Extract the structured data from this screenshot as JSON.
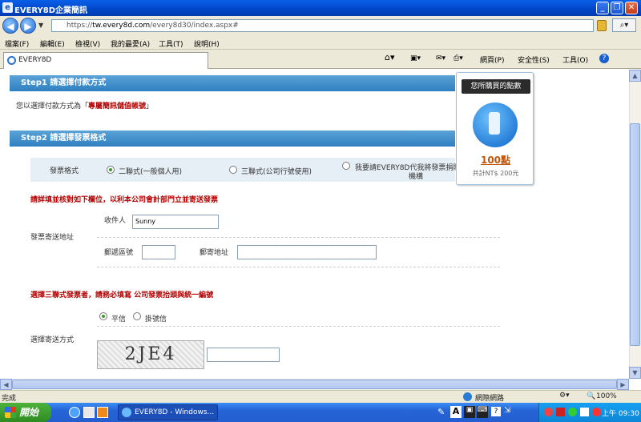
{
  "window": {
    "title": "EVERY8D企業簡訊"
  },
  "address": {
    "prefix": "https://",
    "host": "tw.every8d.com",
    "path": "/every8d30/index.aspx#"
  },
  "menu": [
    "檔案(F)",
    "編輯(E)",
    "檢視(V)",
    "我的最愛(A)",
    "工具(T)",
    "說明(H)"
  ],
  "tab": {
    "label": "EVERY8D"
  },
  "toolbar": {
    "page": "網頁(P)",
    "safety": "安全性(S)",
    "tools": "工具(O)",
    "help": "?"
  },
  "step1": {
    "title": "Step1 請選擇付款方式",
    "prefix": "您以選擇付款方式為「",
    "method": "專屬簡訊儲值帳號",
    "suffix": "」"
  },
  "step2": {
    "title": "Step2 請選擇發票格式",
    "format_label": "發票格式",
    "options": [
      "二聯式(一般個人用)",
      "三聯式(公司行號使用)",
      "我要請EVERY8D代我將發票捐贈",
      "機構"
    ],
    "selected": 0,
    "notice1": "請詳填並核對如下欄位，以利本公司會計部門立並寄送發票",
    "address_label": "發票寄送地址",
    "recipient_label": "收件人",
    "recipient_value": "Sunny",
    "zip_label": "郵遞區號",
    "mail_label": "郵寄地址",
    "notice2": "選擇三聯式發票者，請務必填寫 公司發票抬頭與統一編號",
    "delivery_label": "選擇寄送方式",
    "delivery_options": [
      "平信",
      "掛號信"
    ],
    "captcha": "2JE4"
  },
  "points_panel": {
    "title": "您所購買的點數",
    "value": "100點",
    "sub": "共計NT$ 200元"
  },
  "status": {
    "left": "完成",
    "zone": "網際網路",
    "zoom": "100%"
  },
  "taskbar": {
    "start": "開始",
    "task": "EVERY8D - Windows...",
    "clock": "上午 09:30"
  }
}
